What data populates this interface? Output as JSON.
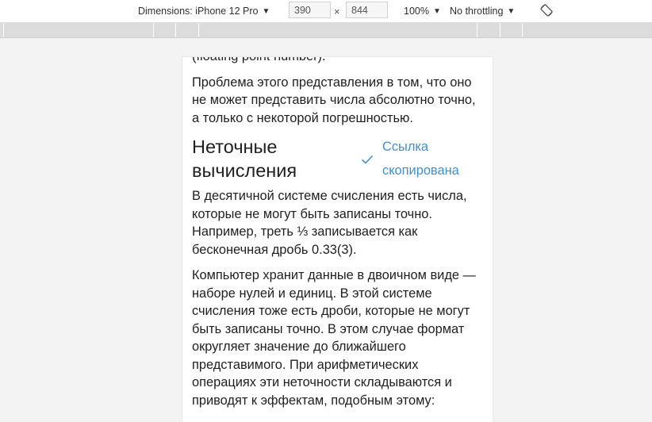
{
  "toolbar": {
    "dimensions_label": "Dimensions: iPhone 12 Pro",
    "width_value": "390",
    "times": "×",
    "height_value": "844",
    "zoom": "100%",
    "throttling": "No throttling",
    "caret": "▼",
    "rotate_icon": "rotate-icon"
  },
  "article": {
    "top_fragment": "(floating point number).",
    "para1": "Проблема этого представления в том, что оно не может представить числа абсолютно точно, а только с некоторой погрешностью.",
    "heading": "Неточные вычисления",
    "copy_notice": "Ссылка скопирована",
    "para2": "В десятичной системе счисления есть числа, которые не могут быть записаны точно. Например, треть ⅓ записывается как бесконечная дробь 0.33(3).",
    "para3": "Компьютер хранит данные в двоичном виде — наборе нулей и единиц. В этой системе счисления тоже есть дроби, которые не могут быть записаны точно. В этом случае формат округляет значение до ближайшего представимого. При арифметических операциях эти неточности складываются и приводят к эффектам, подобным этому:"
  },
  "colors": {
    "link": "#3d8fd6",
    "text": "#1f1f1f"
  }
}
